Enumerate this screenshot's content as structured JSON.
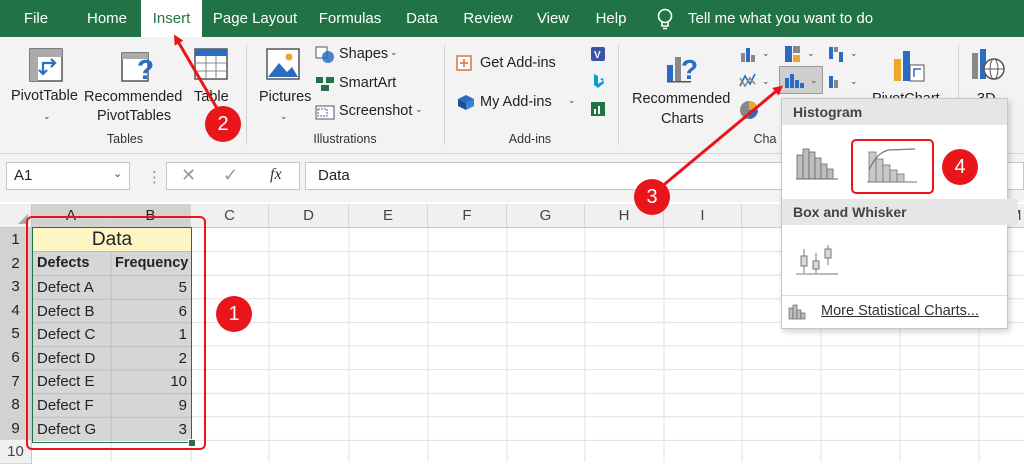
{
  "menu": {
    "tabs": [
      "File",
      "Home",
      "Insert",
      "Page Layout",
      "Formulas",
      "Data",
      "Review",
      "View",
      "Help"
    ],
    "active_tab": "Insert",
    "tell_me": "Tell me what you want to do"
  },
  "ribbon": {
    "pivottable": "PivotTable",
    "recommended_pivottables": [
      "Recommended",
      "PivotTables"
    ],
    "table": "Table",
    "tables_group": "Tables",
    "pictures": "Pictures",
    "shapes": "Shapes",
    "smartart": "SmartArt",
    "screenshot": "Screenshot",
    "illustrations_group": "Illustrations",
    "get_addins": "Get Add-ins",
    "my_addins": "My Add-ins",
    "addins_group": "Add-ins",
    "recommended_charts": [
      "Recommended",
      "Charts"
    ],
    "charts_group": "Cha",
    "pivotchart": "PivotChart",
    "threed": "3D"
  },
  "formula_bar": {
    "name_box": "A1",
    "fx": "fx",
    "value": "Data"
  },
  "grid": {
    "columns": [
      "A",
      "B",
      "C",
      "D",
      "E",
      "F",
      "G",
      "H",
      "I",
      "",
      "",
      "",
      "M"
    ],
    "rows": [
      "1",
      "2",
      "3",
      "4",
      "5",
      "6",
      "7",
      "8",
      "9",
      "10"
    ],
    "title": "Data",
    "headers": [
      "Defects",
      "Frequency"
    ],
    "data": [
      [
        "Defect A",
        "5"
      ],
      [
        "Defect B",
        "6"
      ],
      [
        "Defect C",
        "1"
      ],
      [
        "Defect D",
        "2"
      ],
      [
        "Defect E",
        "10"
      ],
      [
        "Defect F",
        "9"
      ],
      [
        "Defect G",
        "3"
      ]
    ]
  },
  "dropdown": {
    "histogram_header": "Histogram",
    "box_whisker_header": "Box and Whisker",
    "more": "More Statistical Charts..."
  },
  "annotations": [
    "1",
    "2",
    "3",
    "4"
  ],
  "colors": {
    "excel_green": "#217346",
    "annotation_red": "#e8151a",
    "selection": "#d2d2d2"
  }
}
